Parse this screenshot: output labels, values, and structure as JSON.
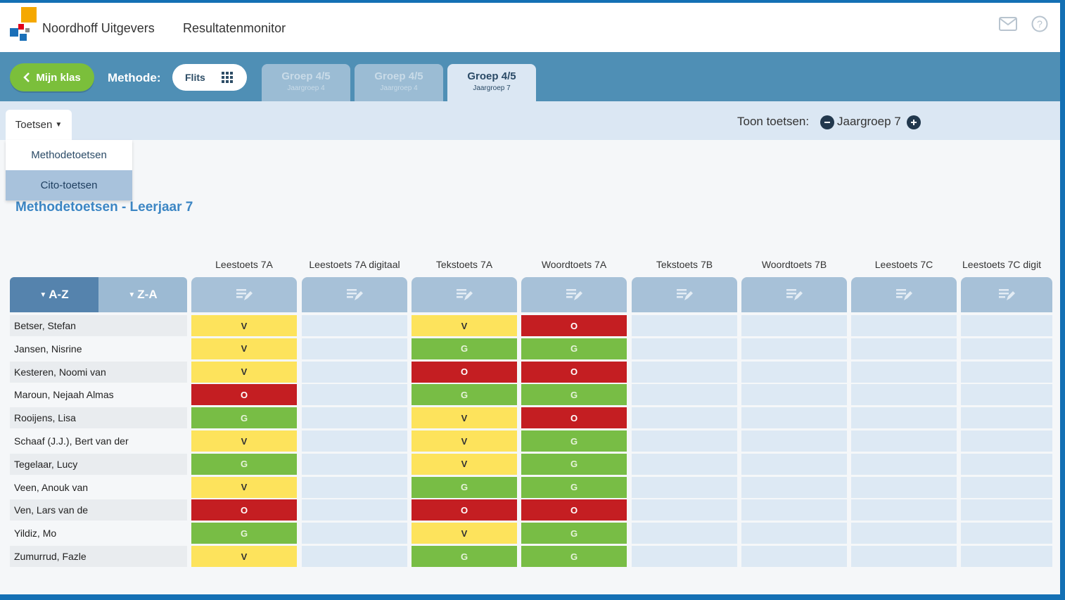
{
  "header": {
    "brand": "Noordhoff Uitgevers",
    "app_name": "Resultatenmonitor"
  },
  "tabbar": {
    "back_label": "Mijn klas",
    "methode_label": "Methode:",
    "methode_value": "Flits",
    "groups": [
      {
        "title": "Groep 4/5",
        "subtitle": "Jaargroep 4",
        "active": false
      },
      {
        "title": "Groep 4/5",
        "subtitle": "Jaargroep 4",
        "active": false
      },
      {
        "title": "Groep 4/5",
        "subtitle": "Jaargroep 7",
        "active": true
      }
    ]
  },
  "subbar": {
    "toetsen_label": "Toetsen",
    "toon_label": "Toon toetsen:",
    "jaargroep_label": "Jaargroep 7"
  },
  "dropdown": {
    "items": [
      "Methodetoetsen",
      "Cito-toetsen"
    ],
    "selected": "Cito-toetsen"
  },
  "page_title": "Methodetoetsen - Leerjaar 7",
  "table": {
    "sort_az": "A-Z",
    "sort_za": "Z-A",
    "columns": [
      "Leestoets 7A",
      "Leestoets 7A digitaal",
      "Tekstoets 7A",
      "Woordtoets 7A",
      "Tekstoets 7B",
      "Woordtoets 7B",
      "Leestoets 7C",
      "Leestoets 7C digit"
    ],
    "students": [
      {
        "name": "Betser, Stefan",
        "scores": [
          "V",
          "",
          "V",
          "O",
          "",
          "",
          "",
          ""
        ]
      },
      {
        "name": "Jansen, Nisrine",
        "scores": [
          "V",
          "",
          "G",
          "G",
          "",
          "",
          "",
          ""
        ]
      },
      {
        "name": "Kesteren, Noomi van",
        "scores": [
          "V",
          "",
          "O",
          "O",
          "",
          "",
          "",
          ""
        ]
      },
      {
        "name": "Maroun, Nejaah Almas",
        "scores": [
          "O",
          "",
          "G",
          "G",
          "",
          "",
          "",
          ""
        ]
      },
      {
        "name": "Rooijens, Lisa",
        "scores": [
          "G",
          "",
          "V",
          "O",
          "",
          "",
          "",
          ""
        ]
      },
      {
        "name": "Schaaf (J.J.), Bert van der",
        "scores": [
          "V",
          "",
          "V",
          "G",
          "",
          "",
          "",
          ""
        ]
      },
      {
        "name": "Tegelaar, Lucy",
        "scores": [
          "G",
          "",
          "V",
          "G",
          "",
          "",
          "",
          ""
        ]
      },
      {
        "name": "Veen, Anouk van",
        "scores": [
          "V",
          "",
          "G",
          "G",
          "",
          "",
          "",
          ""
        ]
      },
      {
        "name": "Ven, Lars van de",
        "scores": [
          "O",
          "",
          "O",
          "O",
          "",
          "",
          "",
          ""
        ]
      },
      {
        "name": "Yildiz, Mo",
        "scores": [
          "G",
          "",
          "V",
          "G",
          "",
          "",
          "",
          ""
        ]
      },
      {
        "name": "Zumurrud, Fazle",
        "scores": [
          "V",
          "",
          "G",
          "G",
          "",
          "",
          "",
          ""
        ]
      }
    ]
  },
  "colors": {
    "good": "#78bd45",
    "sufficient": "#fde35c",
    "insufficient": "#c41e22",
    "accent": "#4f8fb5"
  },
  "icons": {
    "mail": "mail-icon",
    "help": "help-icon",
    "grid": "grid-icon",
    "edit": "edit-note-icon"
  }
}
